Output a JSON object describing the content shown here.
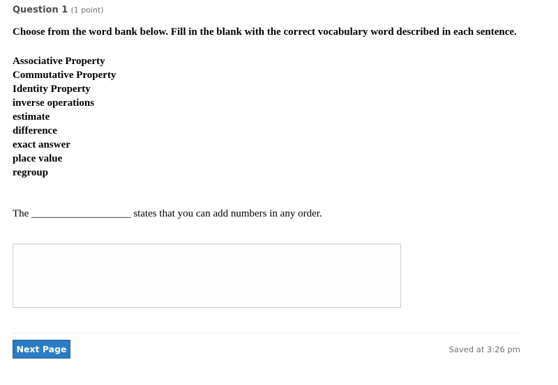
{
  "question": {
    "title": "Question 1",
    "points": "(1 point)",
    "instructions": "Choose from the word bank below. Fill in the blank with the correct vocabulary word described in each sentence.",
    "word_bank": [
      "Associative Property",
      "Commutative Property",
      "Identity Property",
      "inverse operations",
      "estimate",
      "difference",
      "exact answer",
      "place value",
      "regroup"
    ],
    "prompt": "The ___________________ states that you can add numbers in any order.",
    "answer": {
      "value": "",
      "placeholder": ""
    }
  },
  "footer": {
    "next_label": "Next Page",
    "saved_status": "Saved at 3:26 pm"
  },
  "colors": {
    "button_bg": "#2b7cc3",
    "header_text": "#494c4e",
    "muted_text": "#6e7376"
  }
}
